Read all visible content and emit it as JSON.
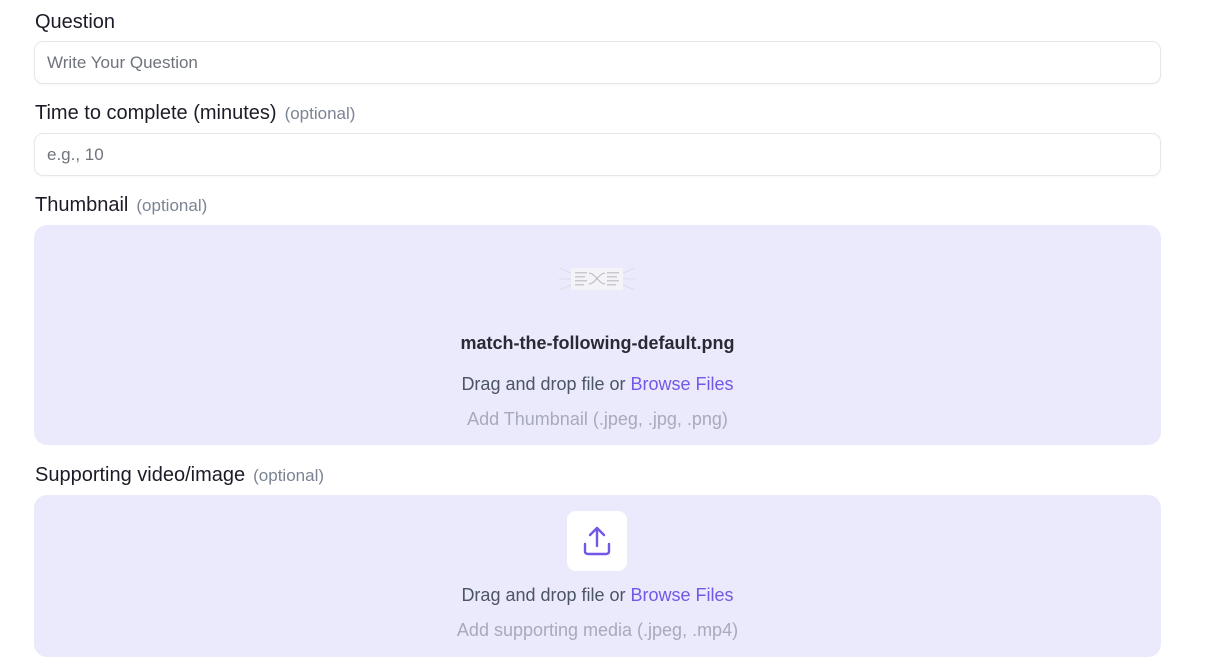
{
  "question": {
    "label": "Question",
    "placeholder": "Write Your Question"
  },
  "time": {
    "label": "Time to complete (minutes)",
    "optional": "(optional)",
    "placeholder": "e.g., 10"
  },
  "thumbnail": {
    "label": "Thumbnail",
    "optional": "(optional)",
    "filename": "match-the-following-default.png",
    "drag_text": "Drag and drop file or ",
    "browse_label": "Browse Files",
    "hint": "Add Thumbnail (.jpeg, .jpg, .png)"
  },
  "supporting": {
    "label": "Supporting video/image",
    "optional": "(optional)",
    "drag_text": "Drag and drop file or ",
    "browse_label": "Browse Files",
    "hint": "Add supporting media (.jpeg, .mp4)"
  },
  "colors": {
    "accent": "#7357e6",
    "dropzone_bg": "#ebeafd"
  },
  "icons": {
    "upload": "upload-icon",
    "thumbnail_preview": "match-the-following-thumbnail"
  }
}
